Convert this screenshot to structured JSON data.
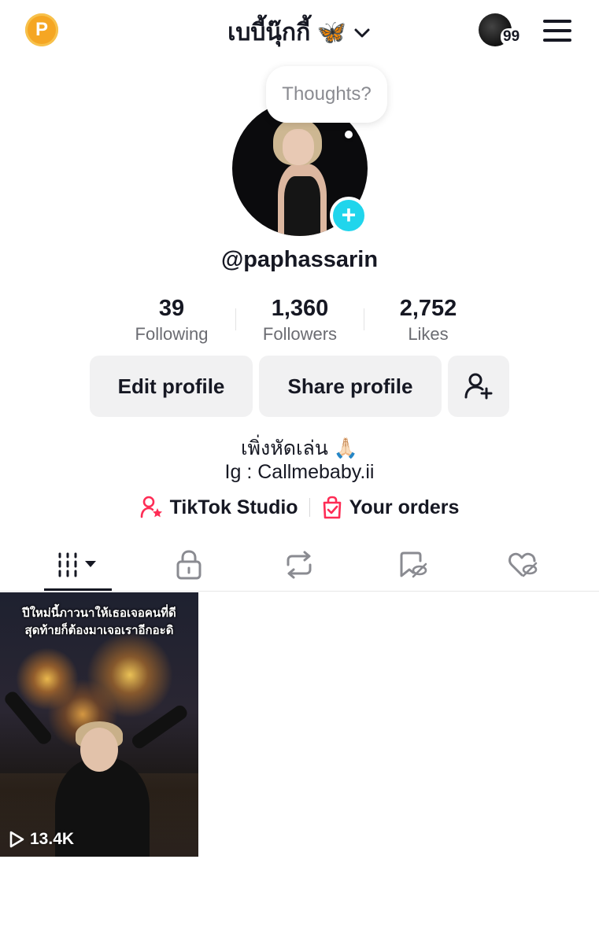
{
  "header": {
    "title": "เบบี้นุ๊กกี้ 🦋",
    "coin_letter": "P",
    "notification_count": "99"
  },
  "profile": {
    "thought_bubble": "Thoughts?",
    "handle": "@paphassarin",
    "stats": [
      {
        "value": "39",
        "label": "Following"
      },
      {
        "value": "1,360",
        "label": "Followers"
      },
      {
        "value": "2,752",
        "label": "Likes"
      }
    ],
    "buttons": {
      "edit": "Edit profile",
      "share": "Share profile"
    },
    "bio_line1": "เพิ่งหัดเล่น 🙏🏻",
    "bio_line2": "Ig : Callmebaby.ii",
    "links": {
      "studio": "TikTok Studio",
      "orders": "Your orders"
    }
  },
  "tabs": [
    {
      "icon": "videos-grid-icon"
    },
    {
      "icon": "lock-icon"
    },
    {
      "icon": "repost-icon"
    },
    {
      "icon": "bookmark-hidden-icon"
    },
    {
      "icon": "liked-hidden-icon"
    }
  ],
  "videos": [
    {
      "caption_line1": "ปีใหม่นี้ภาวนาให้เธอเจอคนที่ดี",
      "caption_line2": "สุดท้ายก็ต้องมาเจอเราอีกอะดิ",
      "views": "13.4K"
    }
  ],
  "colors": {
    "accent_cyan": "#20d5ec",
    "brand_red": "#fe2c55",
    "coin": "#f5a623",
    "text": "#161823",
    "secondary_text": "#6b6c72",
    "button_bg": "#f1f1f2"
  }
}
